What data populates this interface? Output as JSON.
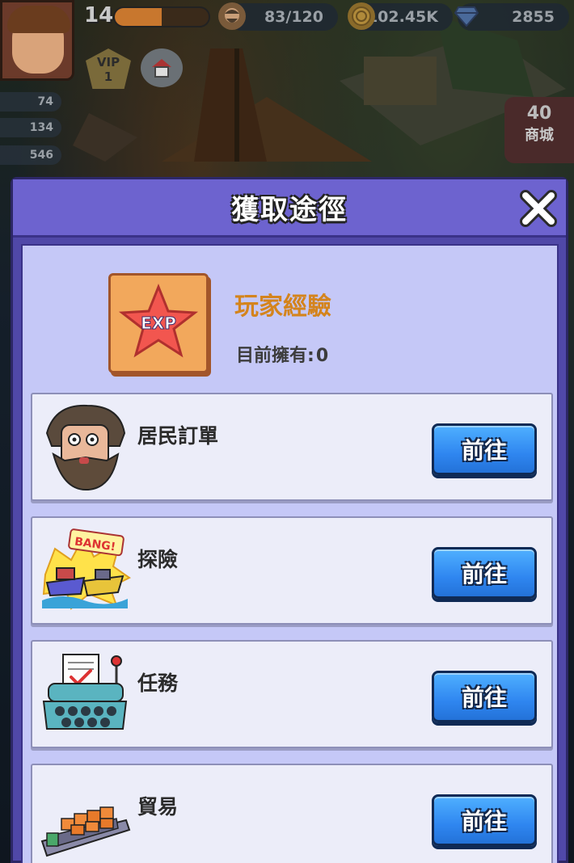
{
  "hud": {
    "level": "14",
    "level_progress": 0.5,
    "population": "83/120",
    "coins": "102.45K",
    "diamonds": "2855",
    "vip_label": "VIP",
    "vip_level": "1",
    "side_stats": [
      "74",
      "134",
      "546"
    ],
    "shop_label": "商城",
    "shop_badge": "40"
  },
  "dialog": {
    "title": "獲取途徑",
    "item": {
      "name": "玩家經驗",
      "icon_text": "EXP",
      "owned_label": "目前擁有:",
      "owned_value": "0"
    },
    "sources": [
      {
        "label": "居民訂單",
        "button": "前往",
        "icon": "villager-icon"
      },
      {
        "label": "探險",
        "button": "前往",
        "icon": "ships-bang-icon"
      },
      {
        "label": "任務",
        "button": "前往",
        "icon": "typewriter-icon"
      },
      {
        "label": "貿易",
        "button": "前往",
        "icon": "cargo-ship-icon"
      }
    ]
  },
  "colors": {
    "dialog_frame": "#5048a8",
    "dialog_header": "#6d63cf",
    "dialog_body": "#c5c8f7",
    "item_name": "#d4841d",
    "go_button": "#2f86f0"
  }
}
